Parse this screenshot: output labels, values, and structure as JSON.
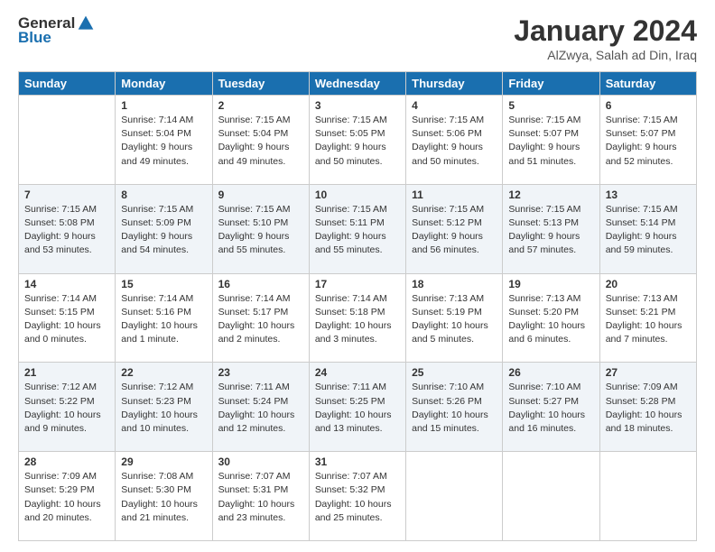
{
  "logo": {
    "general": "General",
    "blue": "Blue"
  },
  "title": "January 2024",
  "location": "AlZwya, Salah ad Din, Iraq",
  "days": [
    "Sunday",
    "Monday",
    "Tuesday",
    "Wednesday",
    "Thursday",
    "Friday",
    "Saturday"
  ],
  "weeks": [
    [
      {
        "day": "",
        "sunrise": "",
        "sunset": "",
        "daylight": ""
      },
      {
        "day": "1",
        "sunrise": "Sunrise: 7:14 AM",
        "sunset": "Sunset: 5:04 PM",
        "daylight": "Daylight: 9 hours and 49 minutes."
      },
      {
        "day": "2",
        "sunrise": "Sunrise: 7:15 AM",
        "sunset": "Sunset: 5:04 PM",
        "daylight": "Daylight: 9 hours and 49 minutes."
      },
      {
        "day": "3",
        "sunrise": "Sunrise: 7:15 AM",
        "sunset": "Sunset: 5:05 PM",
        "daylight": "Daylight: 9 hours and 50 minutes."
      },
      {
        "day": "4",
        "sunrise": "Sunrise: 7:15 AM",
        "sunset": "Sunset: 5:06 PM",
        "daylight": "Daylight: 9 hours and 50 minutes."
      },
      {
        "day": "5",
        "sunrise": "Sunrise: 7:15 AM",
        "sunset": "Sunset: 5:07 PM",
        "daylight": "Daylight: 9 hours and 51 minutes."
      },
      {
        "day": "6",
        "sunrise": "Sunrise: 7:15 AM",
        "sunset": "Sunset: 5:07 PM",
        "daylight": "Daylight: 9 hours and 52 minutes."
      }
    ],
    [
      {
        "day": "7",
        "sunrise": "Sunrise: 7:15 AM",
        "sunset": "Sunset: 5:08 PM",
        "daylight": "Daylight: 9 hours and 53 minutes."
      },
      {
        "day": "8",
        "sunrise": "Sunrise: 7:15 AM",
        "sunset": "Sunset: 5:09 PM",
        "daylight": "Daylight: 9 hours and 54 minutes."
      },
      {
        "day": "9",
        "sunrise": "Sunrise: 7:15 AM",
        "sunset": "Sunset: 5:10 PM",
        "daylight": "Daylight: 9 hours and 55 minutes."
      },
      {
        "day": "10",
        "sunrise": "Sunrise: 7:15 AM",
        "sunset": "Sunset: 5:11 PM",
        "daylight": "Daylight: 9 hours and 55 minutes."
      },
      {
        "day": "11",
        "sunrise": "Sunrise: 7:15 AM",
        "sunset": "Sunset: 5:12 PM",
        "daylight": "Daylight: 9 hours and 56 minutes."
      },
      {
        "day": "12",
        "sunrise": "Sunrise: 7:15 AM",
        "sunset": "Sunset: 5:13 PM",
        "daylight": "Daylight: 9 hours and 57 minutes."
      },
      {
        "day": "13",
        "sunrise": "Sunrise: 7:15 AM",
        "sunset": "Sunset: 5:14 PM",
        "daylight": "Daylight: 9 hours and 59 minutes."
      }
    ],
    [
      {
        "day": "14",
        "sunrise": "Sunrise: 7:14 AM",
        "sunset": "Sunset: 5:15 PM",
        "daylight": "Daylight: 10 hours and 0 minutes."
      },
      {
        "day": "15",
        "sunrise": "Sunrise: 7:14 AM",
        "sunset": "Sunset: 5:16 PM",
        "daylight": "Daylight: 10 hours and 1 minute."
      },
      {
        "day": "16",
        "sunrise": "Sunrise: 7:14 AM",
        "sunset": "Sunset: 5:17 PM",
        "daylight": "Daylight: 10 hours and 2 minutes."
      },
      {
        "day": "17",
        "sunrise": "Sunrise: 7:14 AM",
        "sunset": "Sunset: 5:18 PM",
        "daylight": "Daylight: 10 hours and 3 minutes."
      },
      {
        "day": "18",
        "sunrise": "Sunrise: 7:13 AM",
        "sunset": "Sunset: 5:19 PM",
        "daylight": "Daylight: 10 hours and 5 minutes."
      },
      {
        "day": "19",
        "sunrise": "Sunrise: 7:13 AM",
        "sunset": "Sunset: 5:20 PM",
        "daylight": "Daylight: 10 hours and 6 minutes."
      },
      {
        "day": "20",
        "sunrise": "Sunrise: 7:13 AM",
        "sunset": "Sunset: 5:21 PM",
        "daylight": "Daylight: 10 hours and 7 minutes."
      }
    ],
    [
      {
        "day": "21",
        "sunrise": "Sunrise: 7:12 AM",
        "sunset": "Sunset: 5:22 PM",
        "daylight": "Daylight: 10 hours and 9 minutes."
      },
      {
        "day": "22",
        "sunrise": "Sunrise: 7:12 AM",
        "sunset": "Sunset: 5:23 PM",
        "daylight": "Daylight: 10 hours and 10 minutes."
      },
      {
        "day": "23",
        "sunrise": "Sunrise: 7:11 AM",
        "sunset": "Sunset: 5:24 PM",
        "daylight": "Daylight: 10 hours and 12 minutes."
      },
      {
        "day": "24",
        "sunrise": "Sunrise: 7:11 AM",
        "sunset": "Sunset: 5:25 PM",
        "daylight": "Daylight: 10 hours and 13 minutes."
      },
      {
        "day": "25",
        "sunrise": "Sunrise: 7:10 AM",
        "sunset": "Sunset: 5:26 PM",
        "daylight": "Daylight: 10 hours and 15 minutes."
      },
      {
        "day": "26",
        "sunrise": "Sunrise: 7:10 AM",
        "sunset": "Sunset: 5:27 PM",
        "daylight": "Daylight: 10 hours and 16 minutes."
      },
      {
        "day": "27",
        "sunrise": "Sunrise: 7:09 AM",
        "sunset": "Sunset: 5:28 PM",
        "daylight": "Daylight: 10 hours and 18 minutes."
      }
    ],
    [
      {
        "day": "28",
        "sunrise": "Sunrise: 7:09 AM",
        "sunset": "Sunset: 5:29 PM",
        "daylight": "Daylight: 10 hours and 20 minutes."
      },
      {
        "day": "29",
        "sunrise": "Sunrise: 7:08 AM",
        "sunset": "Sunset: 5:30 PM",
        "daylight": "Daylight: 10 hours and 21 minutes."
      },
      {
        "day": "30",
        "sunrise": "Sunrise: 7:07 AM",
        "sunset": "Sunset: 5:31 PM",
        "daylight": "Daylight: 10 hours and 23 minutes."
      },
      {
        "day": "31",
        "sunrise": "Sunrise: 7:07 AM",
        "sunset": "Sunset: 5:32 PM",
        "daylight": "Daylight: 10 hours and 25 minutes."
      },
      {
        "day": "",
        "sunrise": "",
        "sunset": "",
        "daylight": ""
      },
      {
        "day": "",
        "sunrise": "",
        "sunset": "",
        "daylight": ""
      },
      {
        "day": "",
        "sunrise": "",
        "sunset": "",
        "daylight": ""
      }
    ]
  ]
}
